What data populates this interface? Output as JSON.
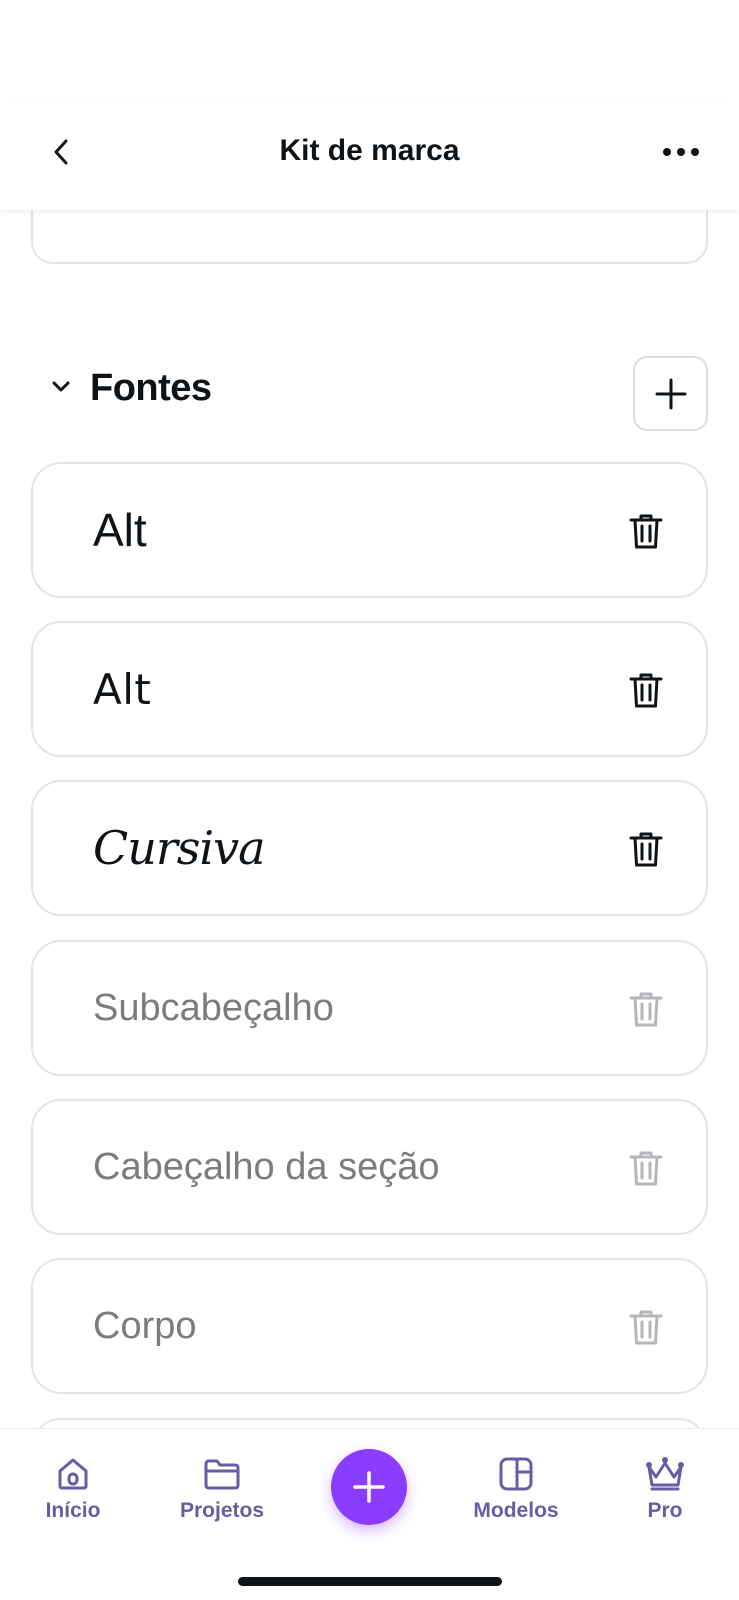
{
  "header": {
    "title": "Kit de marca",
    "back_icon": "chevron-left-icon",
    "more_icon": "more-horizontal-icon"
  },
  "section": {
    "title": "Fontes",
    "collapse_icon": "chevron-down-icon",
    "add_icon": "plus-icon"
  },
  "fonts": [
    {
      "label": "Alt",
      "state": "active"
    },
    {
      "label": "Alt",
      "state": "active"
    },
    {
      "label": "Cursiva",
      "state": "active"
    },
    {
      "label": "Subcabeçalho",
      "state": "placeholder"
    },
    {
      "label": "Cabeçalho da seção",
      "state": "placeholder"
    },
    {
      "label": "Corpo",
      "state": "placeholder"
    }
  ],
  "tabbar": {
    "items": [
      {
        "label": "Início",
        "icon": "home-icon"
      },
      {
        "label": "Projetos",
        "icon": "folder-icon"
      },
      {
        "label": "Modelos",
        "icon": "templates-icon"
      },
      {
        "label": "Pro",
        "icon": "crown-icon"
      }
    ],
    "create_icon": "plus-icon"
  },
  "colors": {
    "accent": "#8b3dff",
    "tab_label": "#6a5ba4",
    "text": "#0e1318",
    "muted_text": "#7a7c80",
    "border": "#e3e4e8"
  }
}
